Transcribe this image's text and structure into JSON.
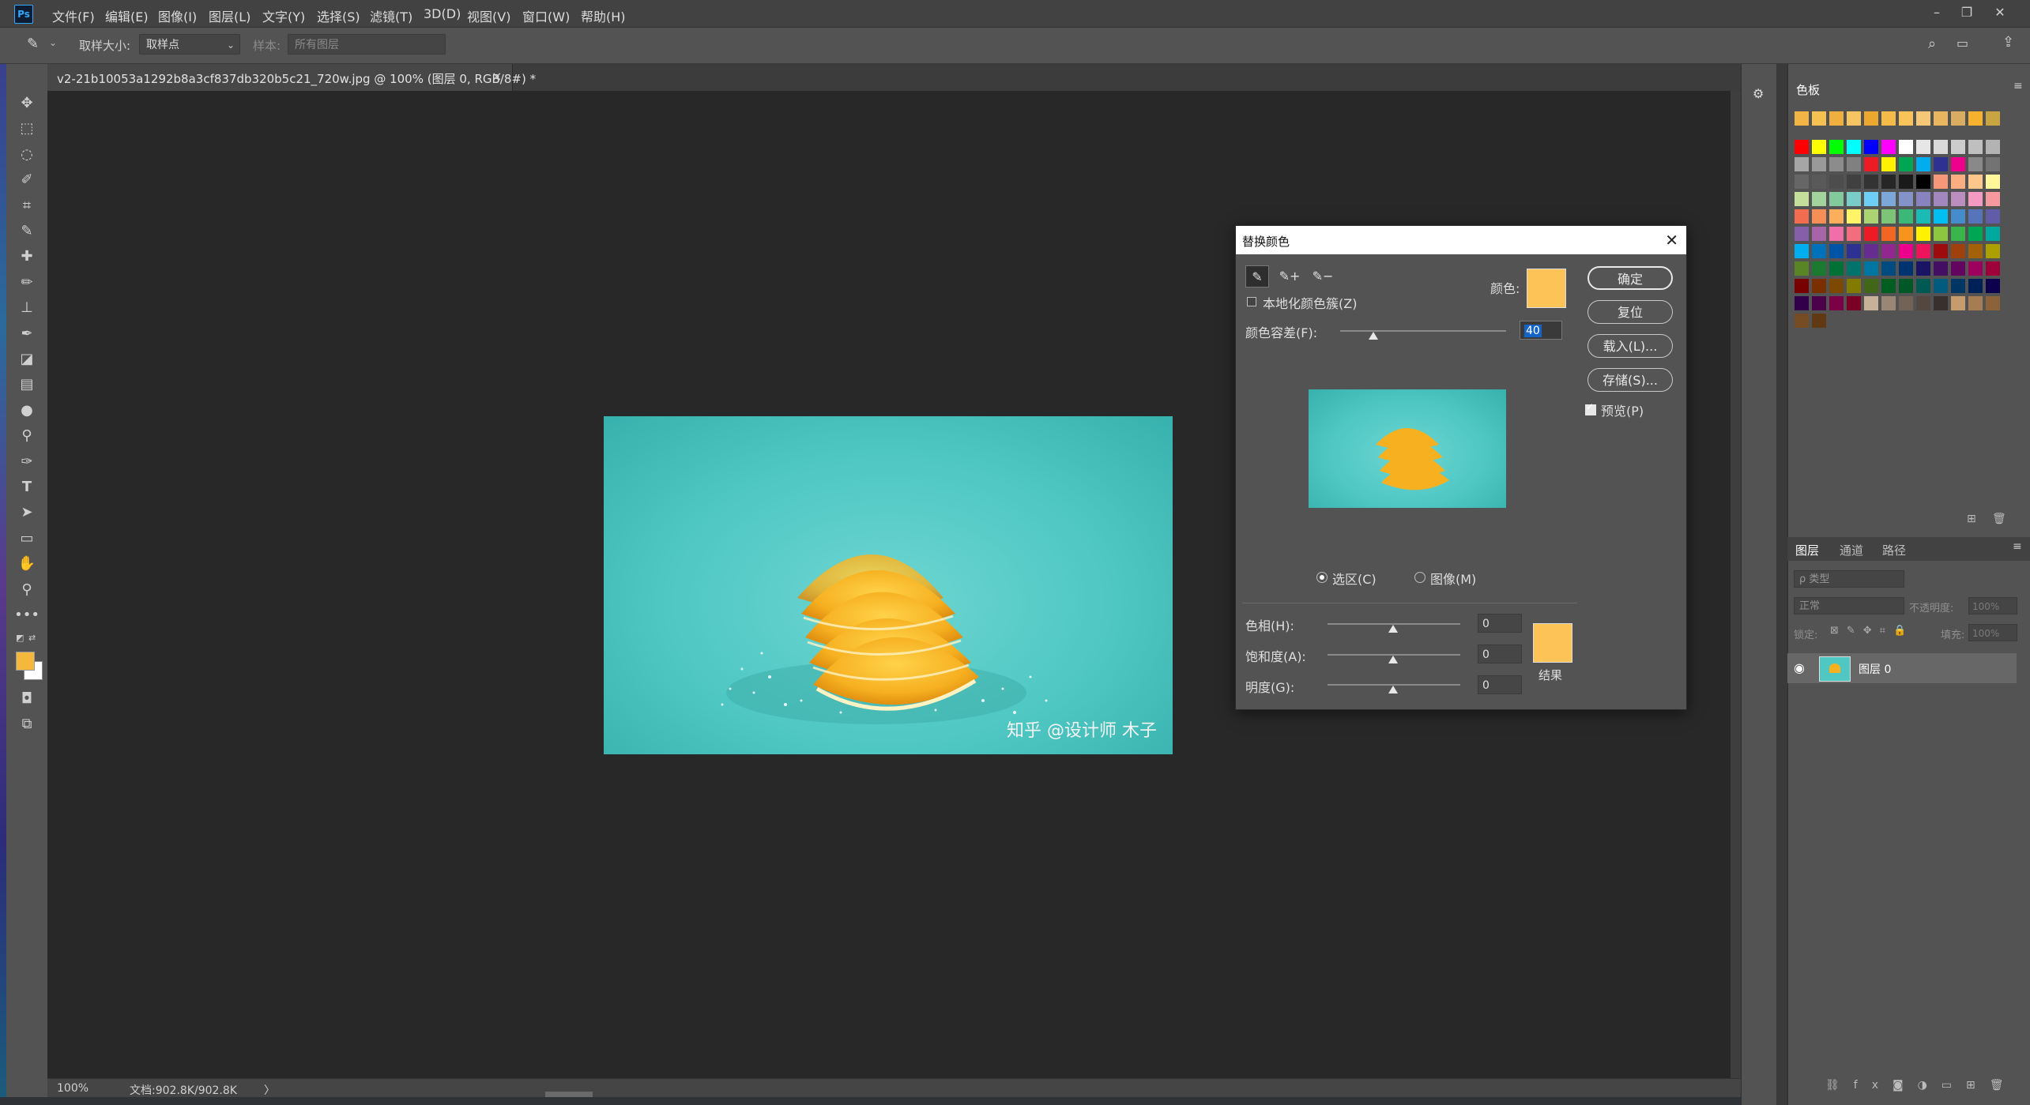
{
  "app": {
    "logo_text": "Ps"
  },
  "menu": [
    "文件(F)",
    "编辑(E)",
    "图像(I)",
    "图层(L)",
    "文字(Y)",
    "选择(S)",
    "滤镜(T)",
    "3D(D)",
    "视图(V)",
    "窗口(W)",
    "帮助(H)"
  ],
  "options_bar": {
    "sample_size_label": "取样大小:",
    "sample_size_value": "取样点",
    "sample_label": "样本:",
    "sample_value": "所有图层"
  },
  "document": {
    "tab_title": "v2-21b10053a1292b8a3cf837db320b5c21_720w.jpg @ 100% (图层 0, RGB/8#) *",
    "watermark": "知乎 @设计师 木子"
  },
  "status": {
    "zoom": "100%",
    "doc_size": "文档:902.8K/902.8K",
    "arrow": "〉"
  },
  "swatches_panel": {
    "tab": "色板",
    "recent": [
      "#f2b545",
      "#f5c150",
      "#f0b040",
      "#f7c462",
      "#eba72e",
      "#f4bb48",
      "#f9c35a",
      "#f5c877",
      "#e9b660",
      "#d8ad62",
      "#f6b22c",
      "#c9a443"
    ],
    "rows": [
      [
        "#ff0000",
        "#ffff00",
        "#00ff00",
        "#00ffff",
        "#0000ff",
        "#ff00ff",
        "#ffffff",
        "#e6e6e6",
        "#d9d9d9",
        "#cccccc",
        "#bfbfbf",
        "#b3b3b3"
      ],
      [
        "#a6a6a6",
        "#999999",
        "#8c8c8c",
        "#808080",
        "#ed1c24",
        "#fff200",
        "#00a651",
        "#00aeef",
        "#2e3192",
        "#ec008c",
        "#898989",
        "#737373"
      ],
      [
        "#666666",
        "#595959",
        "#4d4d4d",
        "#404040",
        "#333333",
        "#262626",
        "#1a1a1a",
        "#000000",
        "#f7977a",
        "#f9ad81",
        "#fdc68a",
        "#fff79a"
      ],
      [
        "#c4df9b",
        "#a3d39c",
        "#82ca9c",
        "#7accc8",
        "#6dcff6",
        "#7da7d9",
        "#8393ca",
        "#8882be",
        "#a187be",
        "#bc8dbf",
        "#f49ac2",
        "#f6989d"
      ],
      [
        "#f26c4f",
        "#f68e55",
        "#fbaf5c",
        "#fff467",
        "#acd372",
        "#7cc576",
        "#3bb878",
        "#1abbb4",
        "#00bff3",
        "#448ccb",
        "#5574b9",
        "#605ca8"
      ],
      [
        "#8560a8",
        "#a864a8",
        "#f06eaa",
        "#f26d7d",
        "#ed1c24",
        "#f26522",
        "#f7941d",
        "#fff200",
        "#8dc63f",
        "#39b54a",
        "#00a651",
        "#00a99d"
      ],
      [
        "#00aeef",
        "#0072bc",
        "#0054a6",
        "#2e3192",
        "#662d91",
        "#92278f",
        "#ec008c",
        "#ed145b",
        "#9e0b0f",
        "#a0410d",
        "#a36209",
        "#aba000"
      ],
      [
        "#598527",
        "#1a7b30",
        "#007236",
        "#00746b",
        "#0076a3",
        "#004b80",
        "#003471",
        "#1b1464",
        "#440e62",
        "#630460",
        "#9e005d",
        "#9e0039"
      ],
      [
        "#790000",
        "#7b2e00",
        "#7d4900",
        "#827b00",
        "#406618",
        "#005e20",
        "#005826",
        "#005952",
        "#005b7f",
        "#003663",
        "#002157",
        "#0d004c"
      ],
      [
        "#32004b",
        "#4b0049",
        "#7b0046",
        "#7a0026",
        "#c7b299",
        "#998675",
        "#736357",
        "#534741",
        "#37302d",
        "#c69c6d",
        "#a67c52",
        "#8c6239"
      ],
      [
        "#754c24",
        "#603913"
      ]
    ]
  },
  "layers_panel": {
    "tabs": [
      "图层",
      "通道",
      "路径"
    ],
    "search_placeholder": "ρ 类型",
    "blend_mode": "正常",
    "opacity_label": "不透明度:",
    "opacity_value": "100%",
    "lock_label": "锁定:",
    "fill_label": "填充:",
    "fill_value": "100%",
    "layer_name": "图层 0"
  },
  "dialog": {
    "title": "替换颜色",
    "localized_label": "本地化颜色簇(Z)",
    "color_label": "颜色:",
    "fuzziness_label": "颜色容差(F):",
    "fuzziness_value": "40",
    "fuzziness_fraction": 0.2,
    "selection_radio": "选区(C)",
    "image_radio": "图像(M)",
    "hue_label": "色相(H):",
    "hue_value": "0",
    "saturation_label": "饱和度(A):",
    "saturation_value": "0",
    "lightness_label": "明度(G):",
    "lightness_value": "0",
    "result_label": "结果",
    "ok": "确定",
    "reset": "复位",
    "load": "载入(L)...",
    "save": "存储(S)...",
    "preview": "预览(P)",
    "picked_color": "#fdc356",
    "result_color": "#fdc356"
  },
  "colors": {
    "foreground": "#f5b83d",
    "background": "#ffffff"
  }
}
